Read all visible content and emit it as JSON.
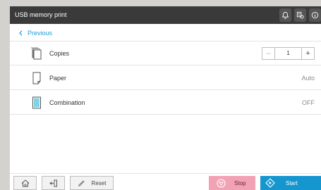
{
  "header": {
    "title": "USB memory print"
  },
  "nav": {
    "back_label": "Previous"
  },
  "settings": {
    "copies": {
      "label": "Copies",
      "value": "1"
    },
    "paper": {
      "label": "Paper",
      "value": "Auto"
    },
    "combination": {
      "label": "Combination",
      "value": "OFF"
    }
  },
  "footer": {
    "reset_label": "Reset",
    "stop_label": "Stop",
    "start_label": "Start"
  },
  "icons": {
    "header": [
      "bell-icon",
      "device-status-icon",
      "info-icon"
    ],
    "rows": [
      "copies-icon",
      "paper-icon",
      "combination-icon"
    ],
    "footer": [
      "home-icon",
      "logout-icon",
      "eraser-icon",
      "stop-icon",
      "start-icon"
    ]
  },
  "colors": {
    "titlebar": "#3a3a3a",
    "accent": "#1a9cd8",
    "start": "#1596cf",
    "stop": "#f2a2b5",
    "combination_icon": "#7fd3e6"
  }
}
